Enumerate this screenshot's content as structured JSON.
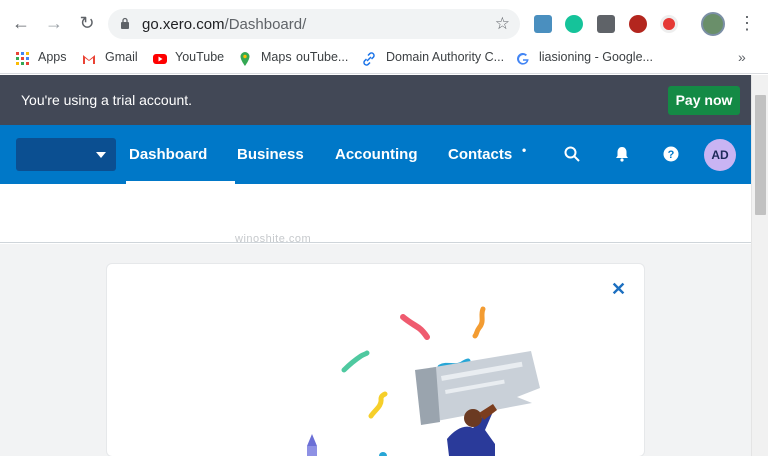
{
  "browser": {
    "url_host": "go.xero.com",
    "url_path": "/Dashboard/",
    "bookmarks": [
      {
        "label": "Apps"
      },
      {
        "label": "Gmail"
      },
      {
        "label": "YouTube"
      },
      {
        "label": "Maps"
      },
      {
        "label": "ouTube..."
      },
      {
        "label": "Domain Authority C..."
      },
      {
        "label": "liasioning - Google..."
      }
    ],
    "more_bookmarks": "»"
  },
  "trial_banner": {
    "message": "You're using a trial account.",
    "pay_label": "Pay now"
  },
  "xero_nav": {
    "items": [
      {
        "label": "Dashboard"
      },
      {
        "label": "Business"
      },
      {
        "label": "Accounting"
      },
      {
        "label": "Contacts"
      }
    ],
    "avatar_initials": "AD"
  },
  "watermark": "winoshite.com",
  "card": {
    "close_symbol": "✕"
  },
  "colors": {
    "xero_blue": "#0078c8",
    "trial_bg": "#424856",
    "pay_green": "#148a45",
    "avatar": "#c9b4f3"
  }
}
